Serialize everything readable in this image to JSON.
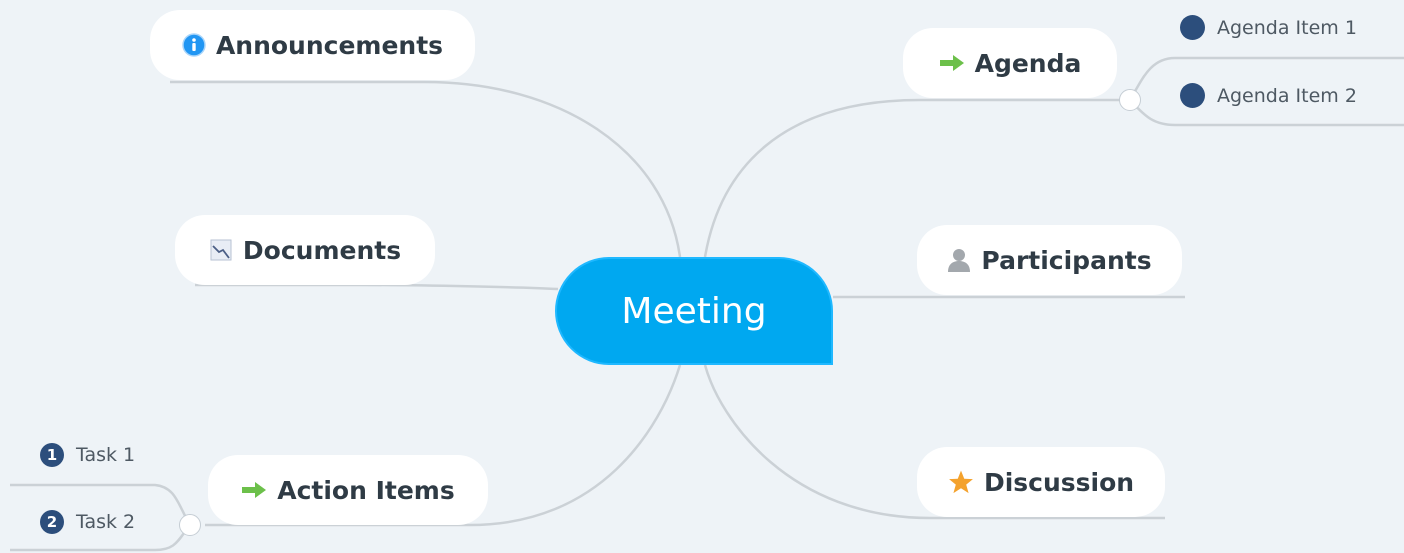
{
  "central": {
    "label": "Meeting"
  },
  "branches": {
    "announcements": {
      "label": "Announcements",
      "icon": "info-icon"
    },
    "documents": {
      "label": "Documents",
      "icon": "document-chart-icon"
    },
    "action_items": {
      "label": "Action Items",
      "icon": "green-arrow-icon",
      "children": [
        {
          "label": "Task 1",
          "badge": "1"
        },
        {
          "label": "Task 2",
          "badge": "2"
        }
      ]
    },
    "agenda": {
      "label": "Agenda",
      "icon": "green-arrow-icon",
      "children": [
        {
          "label": "Agenda Item 1"
        },
        {
          "label": "Agenda Item 2"
        }
      ]
    },
    "participants": {
      "label": "Participants",
      "icon": "person-icon"
    },
    "discussion": {
      "label": "Discussion",
      "icon": "star-icon"
    }
  },
  "colors": {
    "background": "#eef3f7",
    "central_fill": "#00a8f0",
    "node_fill": "#ffffff",
    "connector": "#cbd1d6",
    "bullet": "#2c4e7c",
    "arrow": "#6cc04a",
    "star": "#f4a22d",
    "info": "#2196f3"
  }
}
